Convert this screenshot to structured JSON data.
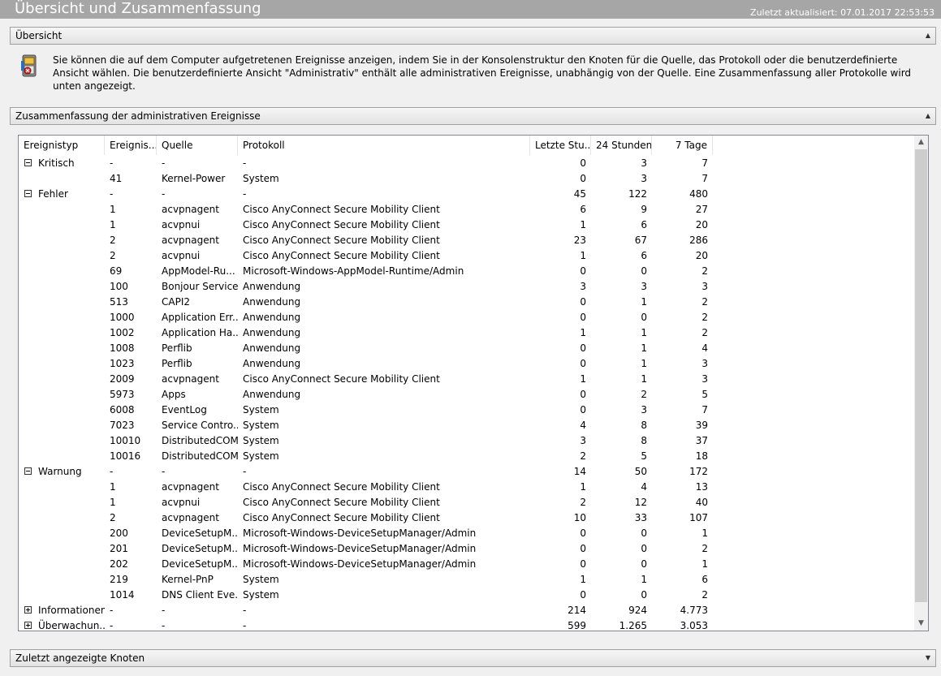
{
  "page": {
    "title": "Übersicht und Zusammenfassung",
    "updated": "Zuletzt aktualisiert: 07.01.2017 22:53:53"
  },
  "overview": {
    "header": "Übersicht",
    "toggle": "▲",
    "icon": "event-log-icon",
    "text": "Sie können die auf dem Computer aufgetretenen Ereignisse anzeigen, indem Sie in der Konsolenstruktur den Knoten für die Quelle, das Protokoll oder die benutzerdefinierte Ansicht wählen. Die benutzerdefinierte Ansicht \"Administrativ\" enthält alle administrativen Ereignisse, unabhängig von der Quelle. Eine Zusammenfassung aller Protokolle wird unten angezeigt."
  },
  "summary": {
    "header": "Zusammenfassung der administrativen Ereignisse",
    "toggle": "▲",
    "columns": [
      "Ereignistyp",
      "Ereignis...",
      "Quelle",
      "Protokoll",
      "Letzte Stu...",
      "24 Stunden",
      "7 Tage"
    ],
    "rows": [
      {
        "type": "Kritisch",
        "expander": "minus",
        "id": "-",
        "source": "-",
        "log": "-",
        "h1": "0",
        "h24": "3",
        "d7": "7"
      },
      {
        "type": "",
        "id": "41",
        "source": "Kernel-Power",
        "log": "System",
        "h1": "0",
        "h24": "3",
        "d7": "7"
      },
      {
        "type": "Fehler",
        "expander": "minus",
        "id": "-",
        "source": "-",
        "log": "-",
        "h1": "45",
        "h24": "122",
        "d7": "480"
      },
      {
        "type": "",
        "id": "1",
        "source": "acvpnagent",
        "log": "Cisco AnyConnect Secure Mobility Client",
        "h1": "6",
        "h24": "9",
        "d7": "27"
      },
      {
        "type": "",
        "id": "1",
        "source": "acvpnui",
        "log": "Cisco AnyConnect Secure Mobility Client",
        "h1": "1",
        "h24": "6",
        "d7": "20"
      },
      {
        "type": "",
        "id": "2",
        "source": "acvpnagent",
        "log": "Cisco AnyConnect Secure Mobility Client",
        "h1": "23",
        "h24": "67",
        "d7": "286"
      },
      {
        "type": "",
        "id": "2",
        "source": "acvpnui",
        "log": "Cisco AnyConnect Secure Mobility Client",
        "h1": "1",
        "h24": "6",
        "d7": "20"
      },
      {
        "type": "",
        "id": "69",
        "source": "AppModel-Ru...",
        "log": "Microsoft-Windows-AppModel-Runtime/Admin",
        "h1": "0",
        "h24": "0",
        "d7": "2"
      },
      {
        "type": "",
        "id": "100",
        "source": "Bonjour Service",
        "log": "Anwendung",
        "h1": "3",
        "h24": "3",
        "d7": "3"
      },
      {
        "type": "",
        "id": "513",
        "source": "CAPI2",
        "log": "Anwendung",
        "h1": "0",
        "h24": "1",
        "d7": "2"
      },
      {
        "type": "",
        "id": "1000",
        "source": "Application Err...",
        "log": "Anwendung",
        "h1": "0",
        "h24": "0",
        "d7": "2"
      },
      {
        "type": "",
        "id": "1002",
        "source": "Application Ha...",
        "log": "Anwendung",
        "h1": "1",
        "h24": "1",
        "d7": "2"
      },
      {
        "type": "",
        "id": "1008",
        "source": "Perflib",
        "log": "Anwendung",
        "h1": "0",
        "h24": "1",
        "d7": "4"
      },
      {
        "type": "",
        "id": "1023",
        "source": "Perflib",
        "log": "Anwendung",
        "h1": "0",
        "h24": "1",
        "d7": "3"
      },
      {
        "type": "",
        "id": "2009",
        "source": "acvpnagent",
        "log": "Cisco AnyConnect Secure Mobility Client",
        "h1": "1",
        "h24": "1",
        "d7": "3"
      },
      {
        "type": "",
        "id": "5973",
        "source": "Apps",
        "log": "Anwendung",
        "h1": "0",
        "h24": "2",
        "d7": "5"
      },
      {
        "type": "",
        "id": "6008",
        "source": "EventLog",
        "log": "System",
        "h1": "0",
        "h24": "3",
        "d7": "7"
      },
      {
        "type": "",
        "id": "7023",
        "source": "Service Contro...",
        "log": "System",
        "h1": "4",
        "h24": "8",
        "d7": "39"
      },
      {
        "type": "",
        "id": "10010",
        "source": "DistributedCOM",
        "log": "System",
        "h1": "3",
        "h24": "8",
        "d7": "37"
      },
      {
        "type": "",
        "id": "10016",
        "source": "DistributedCOM",
        "log": "System",
        "h1": "2",
        "h24": "5",
        "d7": "18"
      },
      {
        "type": "Warnung",
        "expander": "minus",
        "id": "-",
        "source": "-",
        "log": "-",
        "h1": "14",
        "h24": "50",
        "d7": "172"
      },
      {
        "type": "",
        "id": "1",
        "source": "acvpnagent",
        "log": "Cisco AnyConnect Secure Mobility Client",
        "h1": "1",
        "h24": "4",
        "d7": "13"
      },
      {
        "type": "",
        "id": "1",
        "source": "acvpnui",
        "log": "Cisco AnyConnect Secure Mobility Client",
        "h1": "2",
        "h24": "12",
        "d7": "40"
      },
      {
        "type": "",
        "id": "2",
        "source": "acvpnagent",
        "log": "Cisco AnyConnect Secure Mobility Client",
        "h1": "10",
        "h24": "33",
        "d7": "107"
      },
      {
        "type": "",
        "id": "200",
        "source": "DeviceSetupM...",
        "log": "Microsoft-Windows-DeviceSetupManager/Admin",
        "h1": "0",
        "h24": "0",
        "d7": "1"
      },
      {
        "type": "",
        "id": "201",
        "source": "DeviceSetupM...",
        "log": "Microsoft-Windows-DeviceSetupManager/Admin",
        "h1": "0",
        "h24": "0",
        "d7": "2"
      },
      {
        "type": "",
        "id": "202",
        "source": "DeviceSetupM...",
        "log": "Microsoft-Windows-DeviceSetupManager/Admin",
        "h1": "0",
        "h24": "0",
        "d7": "1"
      },
      {
        "type": "",
        "id": "219",
        "source": "Kernel-PnP",
        "log": "System",
        "h1": "1",
        "h24": "1",
        "d7": "6"
      },
      {
        "type": "",
        "id": "1014",
        "source": "DNS Client Eve...",
        "log": "System",
        "h1": "0",
        "h24": "0",
        "d7": "2"
      },
      {
        "type": "Informationen",
        "expander": "plus",
        "id": "-",
        "source": "-",
        "log": "-",
        "h1": "214",
        "h24": "924",
        "d7": "4.773"
      },
      {
        "type": "Überwachun...",
        "expander": "plus",
        "id": "-",
        "source": "-",
        "log": "-",
        "h1": "599",
        "h24": "1.265",
        "d7": "3.053"
      }
    ]
  },
  "recent": {
    "header": "Zuletzt angezeigte Knoten",
    "toggle": "▼"
  },
  "scrollbar": {
    "up": "▲",
    "down": "▼"
  }
}
